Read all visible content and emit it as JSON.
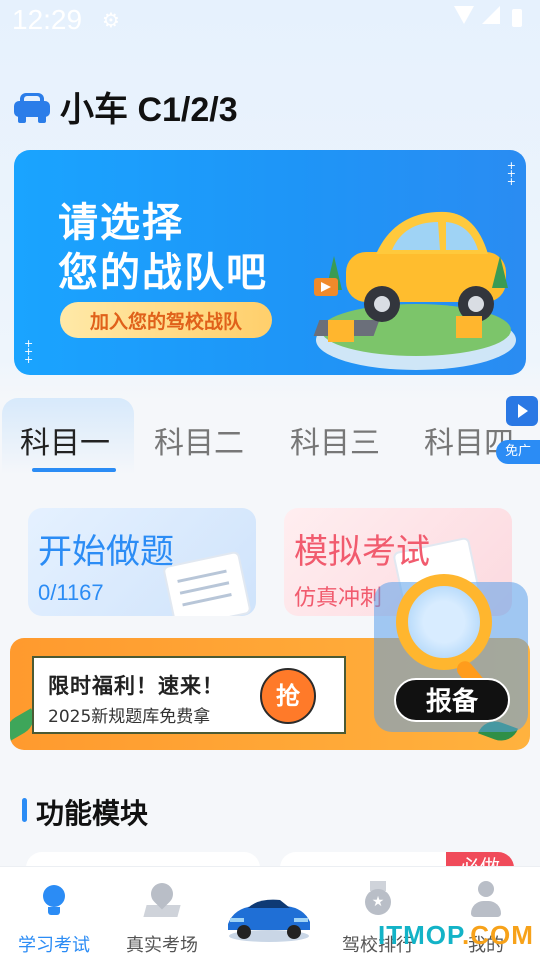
{
  "status_bar": {
    "time": "12:29",
    "gear_icon": "gear-icon",
    "wifi_icon": "wifi-icon",
    "signal_icon": "signal-icon",
    "battery_icon": "battery-icon"
  },
  "header": {
    "icon": "car-icon",
    "title": "小车 C1/2/3"
  },
  "banner": {
    "line1": "请选择",
    "line2": "您的战队吧",
    "button_label": "加入您的驾校战队",
    "dots": "+\n+\n+",
    "dots2": "+\n+\n+"
  },
  "tabs": {
    "items": [
      {
        "label": "科目一",
        "active": true
      },
      {
        "label": "科目二",
        "active": false
      },
      {
        "label": "科目三",
        "active": false
      },
      {
        "label": "科目四",
        "active": false
      }
    ],
    "ad_label": "免广告"
  },
  "cards": {
    "practice": {
      "title": "开始做题",
      "progress": "0/1167"
    },
    "exam": {
      "title": "模拟考试",
      "subtitle": "仿真冲刺"
    }
  },
  "promo": {
    "title": "限时福利！速来！",
    "subtitle": "2025新规题库免费拿",
    "grab_label": "抢"
  },
  "float_register": {
    "label": "报备",
    "icon": "magnifier-icon"
  },
  "section": {
    "title": "功能模块"
  },
  "module_tag": "必做",
  "bottom_nav": {
    "items": [
      {
        "label": "学习考试",
        "icon": "lightbulb-icon",
        "active": true
      },
      {
        "label": "真实考场",
        "icon": "map-pin-icon",
        "active": false
      },
      {
        "label": "",
        "icon": "car-center-icon",
        "active": false
      },
      {
        "label": "驾校排行",
        "icon": "medal-icon",
        "active": false
      },
      {
        "label": "我的",
        "icon": "person-icon",
        "active": false
      }
    ]
  },
  "watermark": {
    "text": "ITMOP",
    "suffix": ".COM"
  },
  "colors": {
    "accent": "#2b8cf5",
    "banner": "#1e95f7",
    "promo": "#ff9a2e",
    "exam": "#f15b6e"
  }
}
